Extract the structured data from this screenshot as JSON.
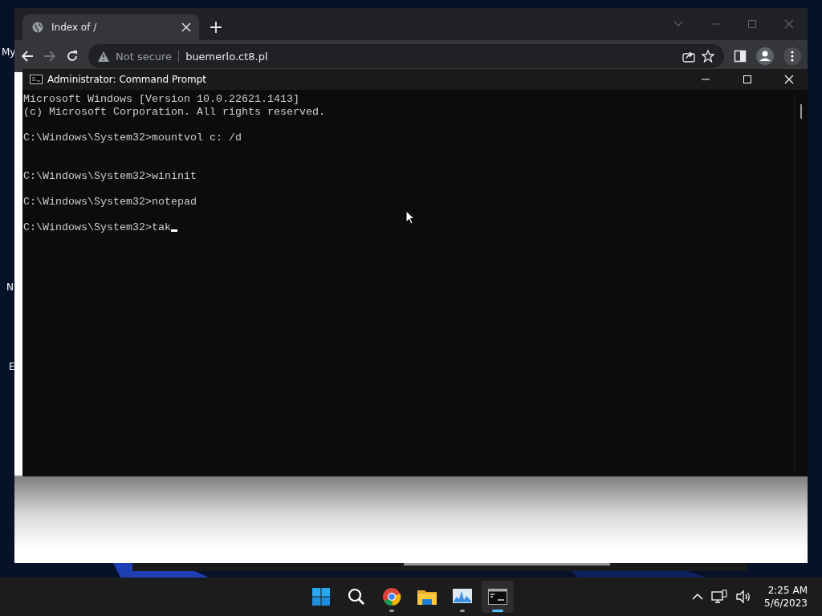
{
  "desktop": {
    "icon_labels": [
      "My",
      "N",
      "E"
    ]
  },
  "browser": {
    "tabs": [
      {
        "title": "Index of /",
        "selected": true
      }
    ],
    "security_label": "Not secure",
    "url": "buemerlo.ct8.pl"
  },
  "console": {
    "title": "Administrator:  Command Prompt",
    "cursor": true,
    "lines": [
      {
        "kind": "text",
        "text": "Microsoft Windows [Version 10.0.22621.1413]"
      },
      {
        "kind": "text",
        "text": "(c) Microsoft Corporation. All rights reserved."
      },
      {
        "kind": "blank"
      },
      {
        "kind": "text",
        "text": "C:\\Windows\\System32>mountvol c: /d"
      },
      {
        "kind": "blank"
      },
      {
        "kind": "blank"
      },
      {
        "kind": "text",
        "text": "C:\\Windows\\System32>wininit"
      },
      {
        "kind": "blank"
      },
      {
        "kind": "text",
        "text": "C:\\Windows\\System32>notepad"
      },
      {
        "kind": "blank"
      },
      {
        "kind": "prompt",
        "text": "C:\\Windows\\System32>tak"
      }
    ]
  },
  "taskbar": {
    "apps": [
      {
        "kind": "start",
        "running": false,
        "selected": false
      },
      {
        "kind": "search",
        "running": false,
        "selected": false
      },
      {
        "kind": "browser",
        "running": true,
        "selected": false
      },
      {
        "kind": "folder",
        "running": false,
        "selected": false
      },
      {
        "kind": "monitor",
        "running": true,
        "selected": false
      },
      {
        "kind": "terminal",
        "running": true,
        "selected": true
      }
    ],
    "time": "2:25 AM",
    "date": "5/6/2023"
  }
}
